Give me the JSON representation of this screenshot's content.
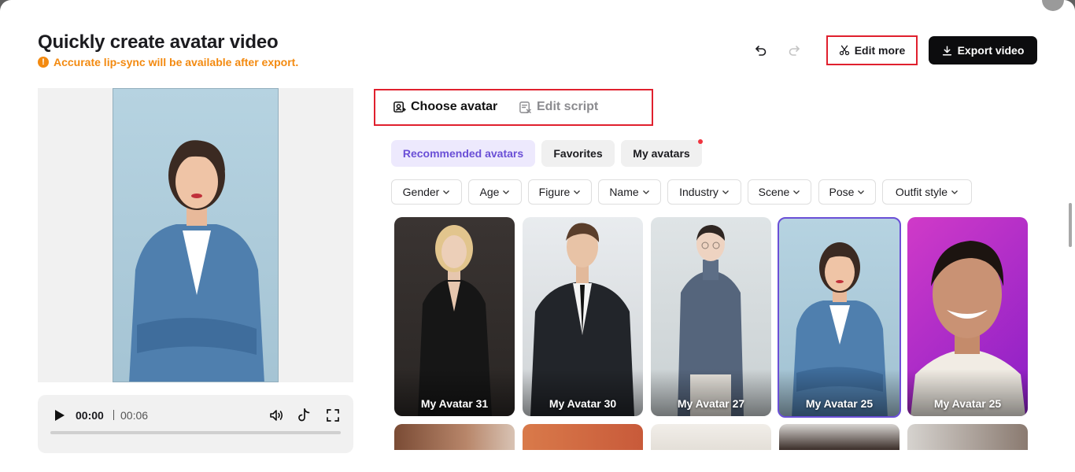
{
  "header": {
    "title": "Quickly create avatar video",
    "warning": "Accurate lip-sync will be available after export.",
    "warning_icon": "!",
    "edit_more_label": "Edit more",
    "export_label": "Export video"
  },
  "player": {
    "current_time": "00:00",
    "total_time": "00:06",
    "progress": 0
  },
  "tabs": [
    {
      "label": "Choose avatar",
      "icon": "avatar-icon",
      "active": true
    },
    {
      "label": "Edit script",
      "icon": "script-icon",
      "active": false
    }
  ],
  "categories": [
    {
      "label": "Recommended avatars",
      "active": true
    },
    {
      "label": "Favorites",
      "active": false
    },
    {
      "label": "My avatars",
      "active": false,
      "badge": "notification-dot"
    }
  ],
  "filters": [
    "Gender",
    "Age",
    "Figure",
    "Name",
    "Industry",
    "Scene",
    "Pose",
    "Outfit style"
  ],
  "avatars": [
    {
      "name": "My Avatar 31",
      "selected": false
    },
    {
      "name": "My Avatar 30",
      "selected": false
    },
    {
      "name": "My Avatar 27",
      "selected": false
    },
    {
      "name": "My Avatar 25",
      "selected": true
    },
    {
      "name": "My Avatar 25",
      "selected": false
    }
  ],
  "colors": {
    "accent": "#6a4fd6",
    "warning": "#f38a10",
    "highlight_box": "#e0202e",
    "primary_button": "#0c0c0e"
  }
}
